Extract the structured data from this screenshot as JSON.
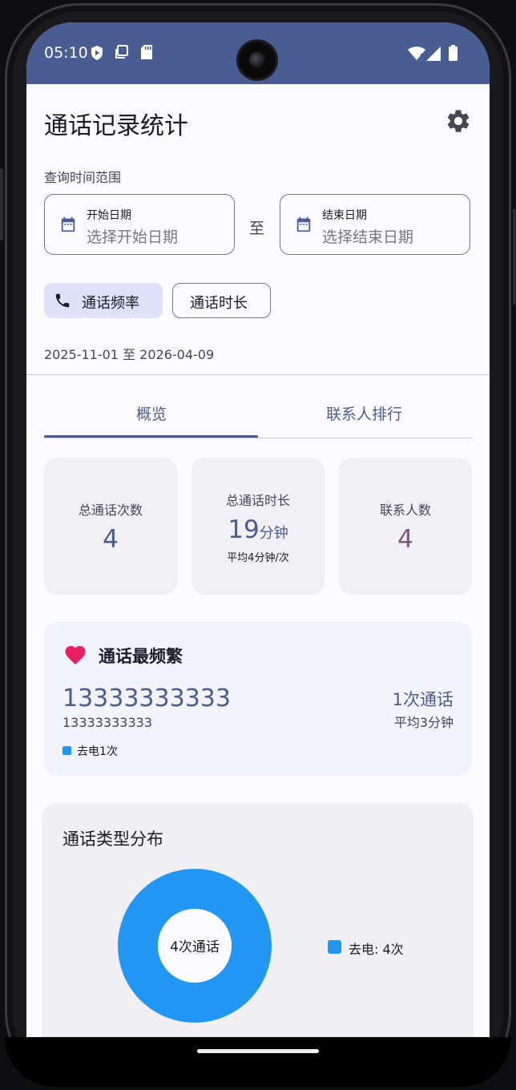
{
  "status_bar": {
    "time": "05:10"
  },
  "header": {
    "title": "通话记录统计",
    "settings_icon": "gear-icon"
  },
  "filter": {
    "range_label": "查询时间范围",
    "start": {
      "label": "开始日期",
      "placeholder": "选择开始日期"
    },
    "separator": "至",
    "end": {
      "label": "结束日期",
      "placeholder": "选择结束日期"
    }
  },
  "chips": {
    "frequency": "通话频率",
    "duration": "通话时长"
  },
  "date_range_text": "2025-11-01 至 2026-04-09",
  "tabs": [
    {
      "label": "概览"
    },
    {
      "label": "联系人排行"
    }
  ],
  "stats": {
    "total_calls": {
      "label": "总通话次数",
      "value": "4"
    },
    "total_duration": {
      "label": "总通话时长",
      "value": "19",
      "unit": "分钟",
      "sub": "平均4分钟/次"
    },
    "contacts": {
      "label": "联系人数",
      "value": "4"
    }
  },
  "most_frequent": {
    "title": "通话最频繁",
    "number": "13333333333",
    "number_sub": "13333333333",
    "legend": "去电1次",
    "count": "1次通话",
    "avg": "平均3分钟"
  },
  "call_types": {
    "title": "通话类型分布",
    "center_text": "4次通话",
    "legend": "去电: 4次"
  },
  "colors": {
    "primary": "#4a5d93",
    "outgoing": "#2196f3",
    "heart": "#e91e63",
    "contacts_value": "#7a5a7a"
  }
}
